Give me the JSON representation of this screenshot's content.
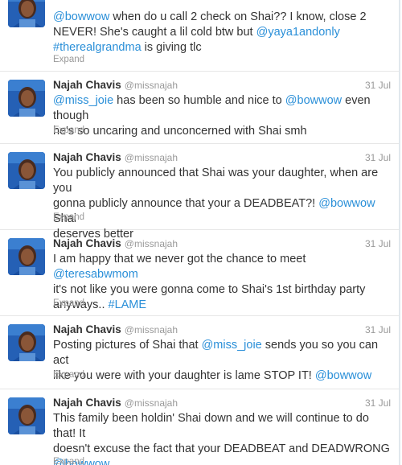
{
  "tweets": [
    {
      "lines": [
        [
          {
            "t": "mention",
            "v": "@bowwow"
          },
          {
            "t": "text",
            "v": " when do u call 2 check on Shai?? I know, close 2"
          }
        ],
        [
          {
            "t": "text",
            "v": "NEVER! She's caught a lil cold btw but "
          },
          {
            "t": "mention",
            "v": "@yaya1andonly"
          }
        ],
        [
          {
            "t": "hashtag",
            "v": "#therealgrandma"
          },
          {
            "t": "text",
            "v": " is giving tlc"
          }
        ]
      ],
      "expand": "Expand"
    },
    {
      "name": "Najah Chavis",
      "handle": "@missnajah",
      "date": "31 Jul",
      "lines": [
        [
          {
            "t": "mention",
            "v": "@miss_joie"
          },
          {
            "t": "text",
            "v": " has been so humble and nice to "
          },
          {
            "t": "mention",
            "v": "@bowwow"
          },
          {
            "t": "text",
            "v": " even though"
          }
        ],
        [
          {
            "t": "text",
            "v": "he's so uncaring and unconcerned with Shai smh"
          }
        ]
      ],
      "expand": "Expand"
    },
    {
      "name": "Najah Chavis",
      "handle": "@missnajah",
      "date": "31 Jul",
      "lines": [
        [
          {
            "t": "text",
            "v": "You publicly announced that Shai was your daughter, when are you"
          }
        ],
        [
          {
            "t": "text",
            "v": "gonna publicly announce that your a DEADBEAT?! "
          },
          {
            "t": "mention",
            "v": "@bowwow"
          },
          {
            "t": "text",
            "v": " Shai"
          }
        ],
        [
          {
            "t": "text",
            "v": "deserves better"
          }
        ]
      ],
      "expand": "Expand"
    },
    {
      "name": "Najah Chavis",
      "handle": "@missnajah",
      "date": "31 Jul",
      "lines": [
        [
          {
            "t": "text",
            "v": "I am happy that we never got the chance to meet "
          },
          {
            "t": "mention",
            "v": "@teresabwmom"
          }
        ],
        [
          {
            "t": "text",
            "v": "it's not like you were gonna come to Shai's 1st birthday party"
          }
        ],
        [
          {
            "t": "text",
            "v": "anyways.. "
          },
          {
            "t": "hashtag",
            "v": "#LAME"
          }
        ]
      ],
      "expand": "Expand"
    },
    {
      "name": "Najah Chavis",
      "handle": "@missnajah",
      "date": "31 Jul",
      "lines": [
        [
          {
            "t": "text",
            "v": "Posting pictures of Shai that "
          },
          {
            "t": "mention",
            "v": "@miss_joie"
          },
          {
            "t": "text",
            "v": " sends you so you can act"
          }
        ],
        [
          {
            "t": "text",
            "v": "like you were with your daughter is lame STOP IT! "
          },
          {
            "t": "mention",
            "v": "@bowwow"
          }
        ]
      ],
      "expand": "Expand"
    },
    {
      "name": "Najah Chavis",
      "handle": "@missnajah",
      "date": "31 Jul",
      "lines": [
        [
          {
            "t": "text",
            "v": "This family been holdin' Shai down and we will continue to do that! It"
          }
        ],
        [
          {
            "t": "text",
            "v": "doesn't excuse the fact that your DEADBEAT and DEADWRONG"
          }
        ],
        [
          {
            "t": "mention",
            "v": "@bowwow"
          }
        ]
      ],
      "expand": "Expand"
    }
  ]
}
